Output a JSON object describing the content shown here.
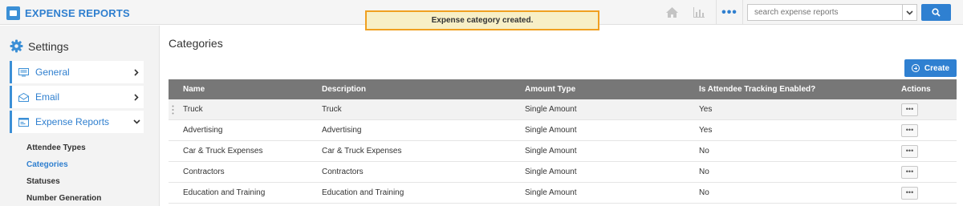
{
  "app": {
    "title": "EXPENSE REPORTS"
  },
  "toast": {
    "message": "Expense category created."
  },
  "search": {
    "placeholder": "search expense reports"
  },
  "colors": {
    "accent": "#2f80d1",
    "toast_border": "#f0a020",
    "table_header": "#777777"
  },
  "sidebar": {
    "heading": "Settings",
    "items": [
      {
        "label": "General",
        "icon": "monitor-icon",
        "chevron": "right"
      },
      {
        "label": "Email",
        "icon": "envelope-icon",
        "chevron": "right"
      },
      {
        "label": "Expense Reports",
        "icon": "card-icon",
        "chevron": "down"
      }
    ],
    "subitems": [
      {
        "label": "Attendee Types",
        "active": false
      },
      {
        "label": "Categories",
        "active": true
      },
      {
        "label": "Statuses",
        "active": false
      },
      {
        "label": "Number Generation",
        "active": false
      }
    ]
  },
  "main": {
    "title": "Categories",
    "create_label": "Create",
    "columns": [
      "Name",
      "Description",
      "Amount Type",
      "Is Attendee Tracking Enabled?",
      "Actions"
    ],
    "rows": [
      {
        "name": "Truck",
        "description": "Truck",
        "amount_type": "Single Amount",
        "attendee": "Yes"
      },
      {
        "name": "Advertising",
        "description": "Advertising",
        "amount_type": "Single Amount",
        "attendee": "Yes"
      },
      {
        "name": "Car & Truck Expenses",
        "description": "Car & Truck Expenses",
        "amount_type": "Single Amount",
        "attendee": "No"
      },
      {
        "name": "Contractors",
        "description": "Contractors",
        "amount_type": "Single Amount",
        "attendee": "No"
      },
      {
        "name": "Education and Training",
        "description": "Education and Training",
        "amount_type": "Single Amount",
        "attendee": "No"
      }
    ]
  }
}
